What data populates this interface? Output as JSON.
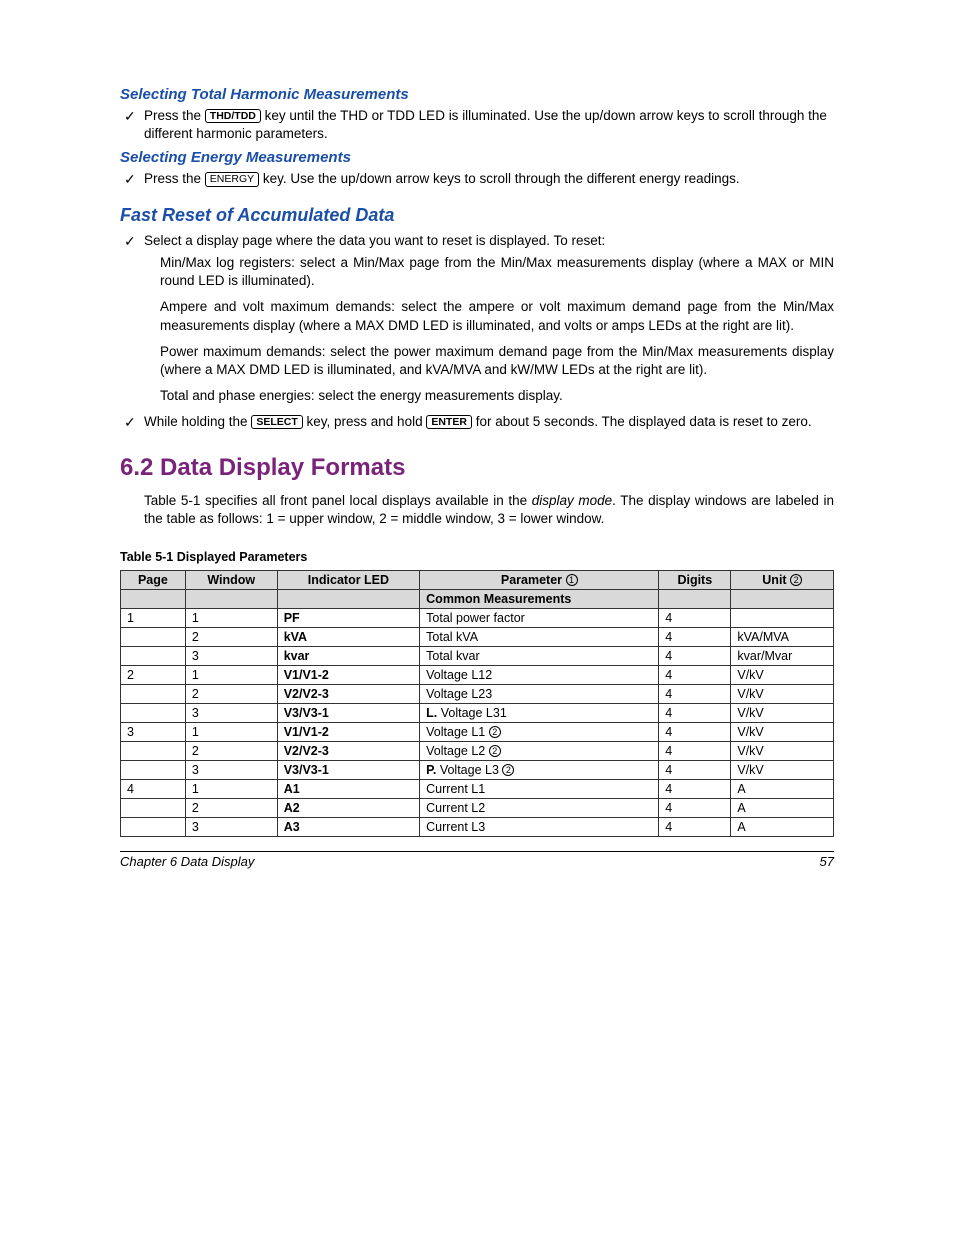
{
  "sections": {
    "harmonic": {
      "title": "Selecting Total Harmonic Measurements",
      "text1a": "Press the ",
      "key1": "THD/TDD",
      "text1b": " key until the THD or TDD LED is illuminated. Use the up/down arrow keys to scroll through the different harmonic parameters."
    },
    "energy": {
      "title": "Selecting Energy Measurements",
      "text1a": "Press the ",
      "key1": "ENERGY",
      "text1b": " key. Use the up/down arrow keys to scroll through the different energy readings."
    },
    "fastreset": {
      "title": "Fast Reset of Accumulated Data",
      "check1": "Select a display page where the data you want to reset is displayed. To reset:",
      "p1": "Min/Max log registers: select a Min/Max page from the Min/Max measurements display (where a MAX or MIN round LED is illuminated).",
      "p2": "Ampere and volt maximum demands: select the ampere or volt maximum demand page from the Min/Max measurements display (where a MAX DMD LED is illuminated, and volts or amps LEDs at the right are lit).",
      "p3": "Power maximum demands: select the power maximum demand page from the Min/Max measurements display (where a MAX DMD LED is illuminated, and kVA/MVA and kW/MW LEDs at the right are lit).",
      "p4": "Total and phase energies: select the energy measurements display.",
      "check2a": "While holding the ",
      "key2a": "SELECT",
      "check2b": " key, press and hold ",
      "key2b": "ENTER",
      "check2c": " for about 5 seconds. The displayed data is reset to zero."
    },
    "ddf": {
      "num_title": "6.2  Data Display Formats",
      "intro1": "Table 5-1 specifies all front panel local displays available in the ",
      "intro_em": "display mode",
      "intro2": ". The display windows are labeled in the table as follows: 1 = upper window, 2 = middle window, 3 = lower window.",
      "tablecaption": "Table 5-1  Displayed Parameters"
    }
  },
  "table": {
    "headers": [
      "Page",
      "Window",
      "Indicator LED",
      "Parameter",
      "Digits",
      "Unit"
    ],
    "param_note": "1",
    "unit_note": "2",
    "subgroup": "Common Measurements",
    "rows": [
      {
        "page": "1",
        "window": "1",
        "led": "PF",
        "param": "Total power factor",
        "digits": "4",
        "unit": ""
      },
      {
        "page": "",
        "window": "2",
        "led": "kVA",
        "param": "Total kVA",
        "digits": "4",
        "unit": "kVA/MVA"
      },
      {
        "page": "",
        "window": "3",
        "led": "kvar",
        "param": "Total kvar",
        "digits": "4",
        "unit": "kvar/Mvar"
      },
      {
        "page": "2",
        "window": "1",
        "led": "V1/V1-2",
        "param": "Voltage L12",
        "digits": "4",
        "unit": "V/kV"
      },
      {
        "page": "",
        "window": "2",
        "led": "V2/V2-3",
        "param": "Voltage L23",
        "digits": "4",
        "unit": "V/kV"
      },
      {
        "page": "",
        "window": "3",
        "led": "V3/V3-1",
        "param_prefix": "L. ",
        "param": "Voltage L31",
        "digits": "4",
        "unit": "V/kV"
      },
      {
        "page": "3",
        "window": "1",
        "led": "V1/V1-2",
        "param": "Voltage L1",
        "note": "2",
        "digits": "4",
        "unit": "V/kV"
      },
      {
        "page": "",
        "window": "2",
        "led": "V2/V2-3",
        "param": "Voltage L2",
        "note": "2",
        "digits": "4",
        "unit": "V/kV"
      },
      {
        "page": "",
        "window": "3",
        "led": "V3/V3-1",
        "param_prefix": "P. ",
        "param": "Voltage L3",
        "note": "2",
        "digits": "4",
        "unit": "V/kV"
      },
      {
        "page": "4",
        "window": "1",
        "led": "A1",
        "param": "Current L1",
        "digits": "4",
        "unit": "A"
      },
      {
        "page": "",
        "window": "2",
        "led": "A2",
        "param": "Current L2",
        "digits": "4",
        "unit": "A"
      },
      {
        "page": "",
        "window": "3",
        "led": "A3",
        "param": "Current L3",
        "digits": "4",
        "unit": "A"
      }
    ]
  },
  "footer": {
    "left": "Chapter 6  Data Display",
    "right": "57"
  }
}
